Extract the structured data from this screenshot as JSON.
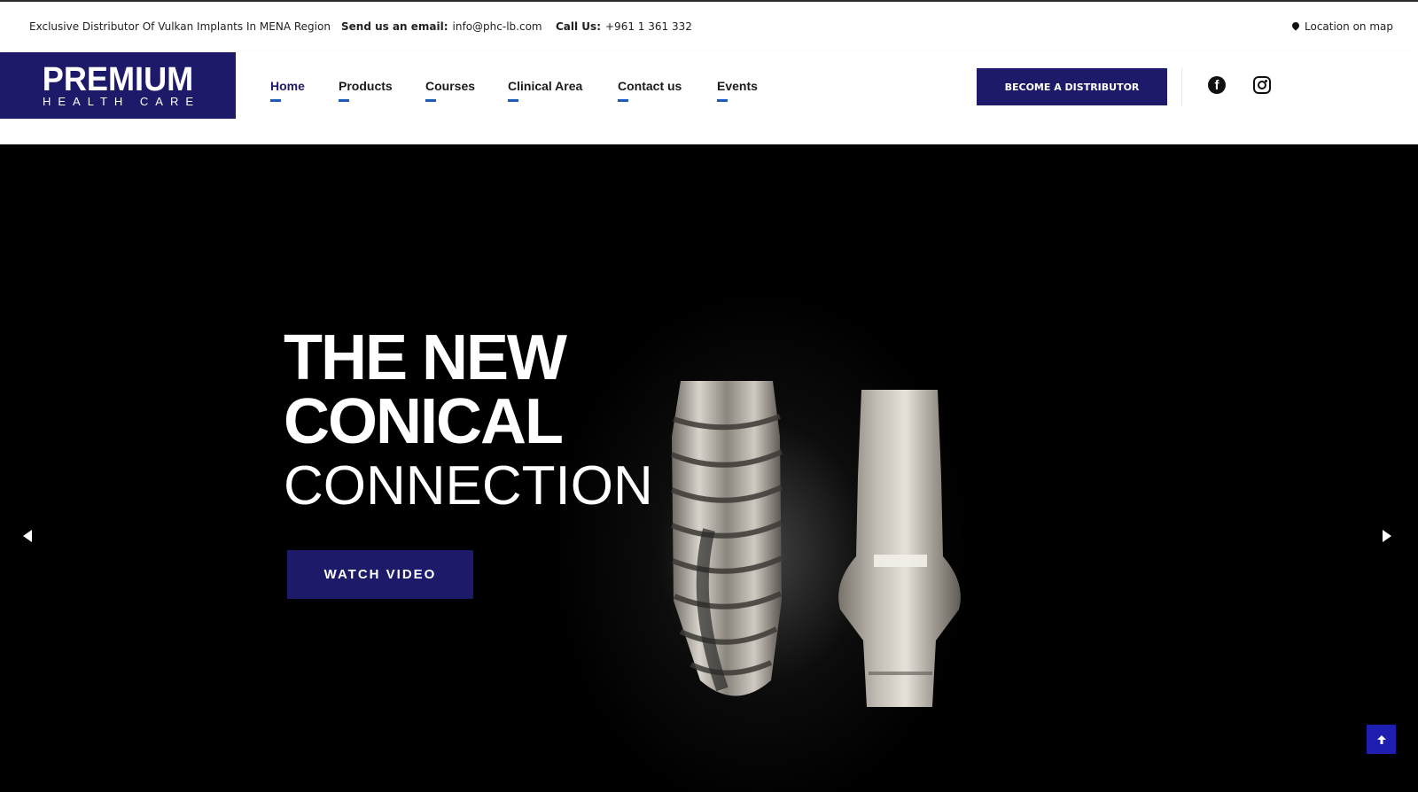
{
  "topbar": {
    "tagline": "Exclusive Distributor Of Vulkan Implants In MENA Region",
    "email_label": "Send us an email:",
    "email_value": "info@phc-lb.com",
    "call_label": "Call Us:",
    "call_value": "+961 1 361 332",
    "location_label": "Location on map"
  },
  "logo": {
    "main": "PREMIUM",
    "sub": "HEALTH CARE"
  },
  "nav": {
    "items": [
      {
        "label": "Home",
        "active": true
      },
      {
        "label": "Products"
      },
      {
        "label": "Courses"
      },
      {
        "label": "Clinical Area"
      },
      {
        "label": "Contact us"
      },
      {
        "label": "Events"
      }
    ]
  },
  "header": {
    "cta_label": "BECOME A DISTRIBUTOR",
    "social": [
      "facebook-icon",
      "instagram-icon"
    ]
  },
  "hero": {
    "line1": "THE NEW",
    "line2": "CONICAL",
    "line3": "CONNECTION",
    "button_label": "WATCH VIDEO"
  },
  "icons": {
    "prev": "chevron-left-icon",
    "next": "chevron-right-icon",
    "scroll_top": "arrow-up-icon"
  },
  "colors": {
    "brand": "#1e1a6a",
    "accent_underline": "#1e5bb5",
    "scroll_button": "#1e1fb0"
  }
}
